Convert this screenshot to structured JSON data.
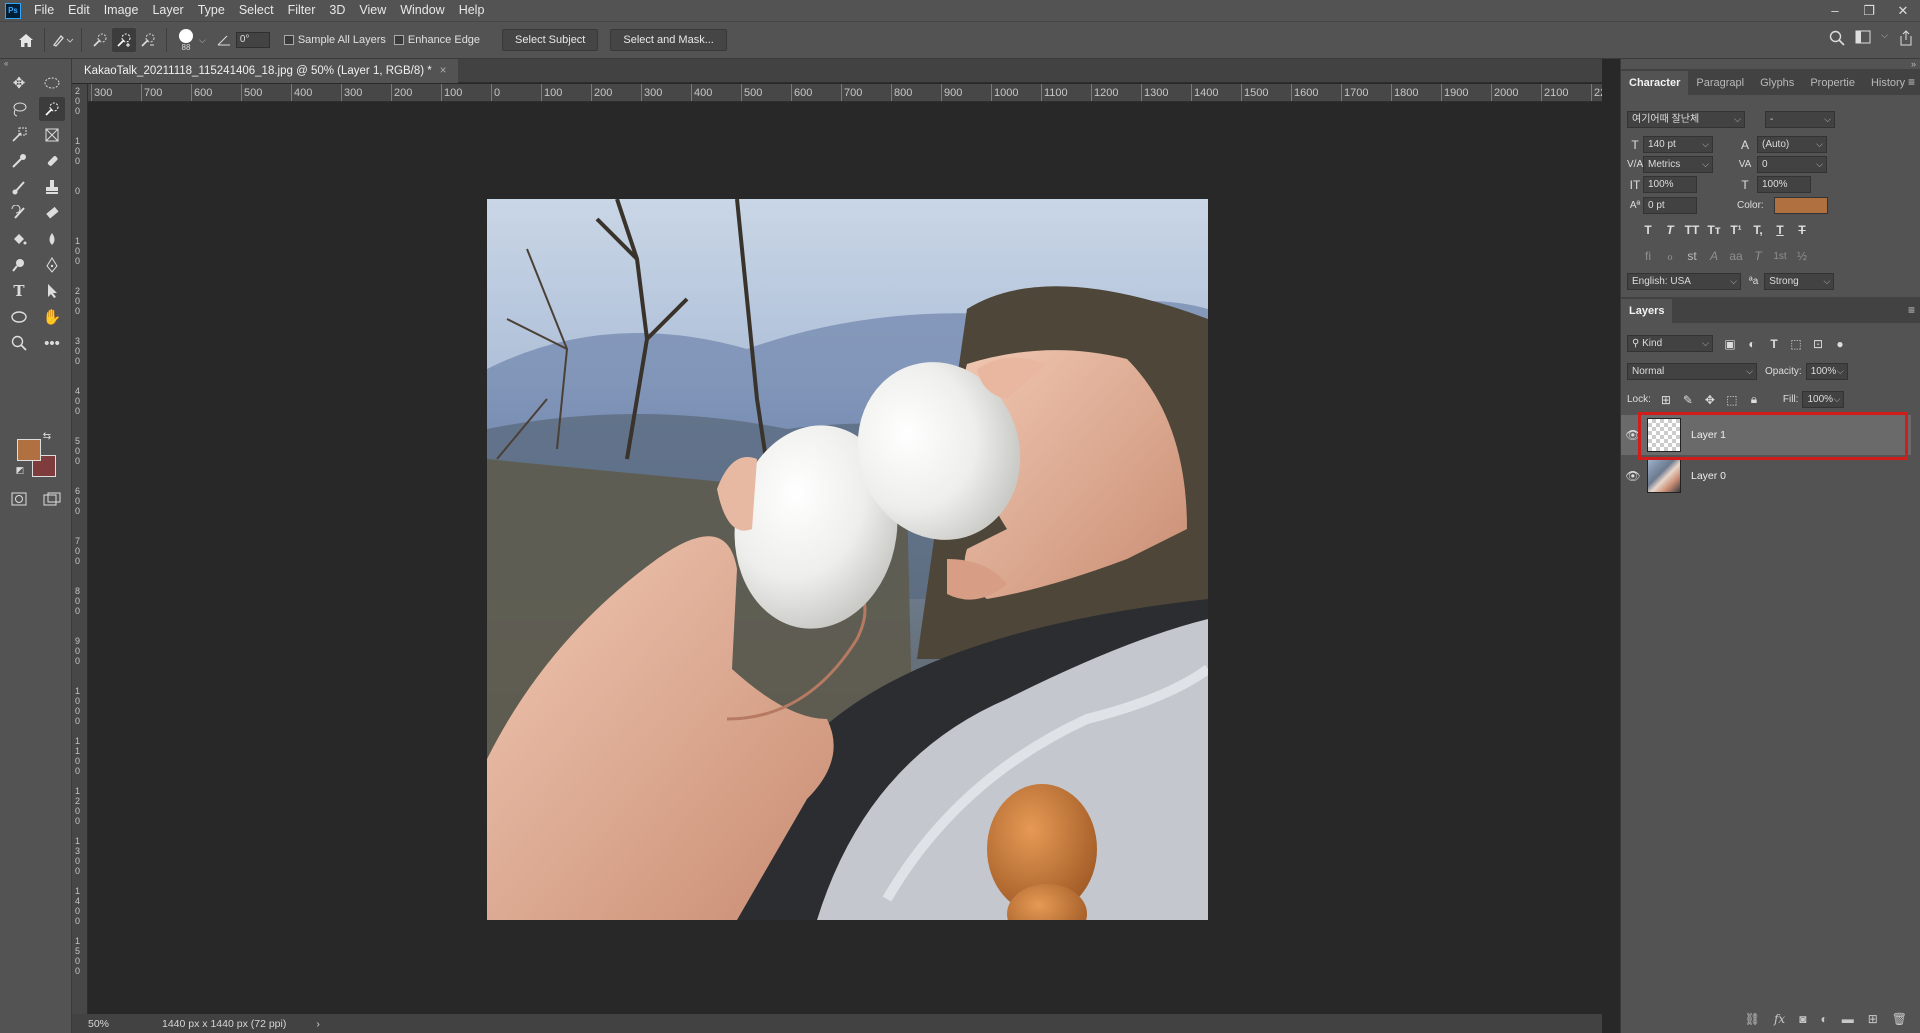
{
  "app": {
    "logo": "Ps"
  },
  "menu": [
    "File",
    "Edit",
    "Image",
    "Layer",
    "Type",
    "Select",
    "Filter",
    "3D",
    "View",
    "Window",
    "Help"
  ],
  "window_controls": {
    "minimize": "–",
    "restore": "❐",
    "close": "✕"
  },
  "options": {
    "brush_size": "88",
    "angle": "0°",
    "sample_all_layers": "Sample All Layers",
    "enhance_edge": "Enhance Edge",
    "select_subject": "Select Subject",
    "select_and_mask": "Select and Mask..."
  },
  "document": {
    "tab_title": "KakaoTalk_20211118_115241406_18.jpg @ 50% (Layer 1, RGB/8) *",
    "close": "×"
  },
  "ruler_h": [
    "300",
    "700",
    "600",
    "500",
    "400",
    "300",
    "200",
    "100",
    "0",
    "100",
    "200",
    "300",
    "400",
    "500",
    "600",
    "700",
    "800",
    "900",
    "1000",
    "1100",
    "1200",
    "1300",
    "1400",
    "1500",
    "1600",
    "1700",
    "1800",
    "1900",
    "2000",
    "2100",
    "22"
  ],
  "ruler_v": [
    "200",
    "100",
    "0",
    "100",
    "200",
    "300",
    "400",
    "500",
    "600",
    "700",
    "800",
    "900",
    "1000",
    "1100",
    "1200",
    "1300",
    "1400",
    "1500"
  ],
  "status": {
    "zoom": "50%",
    "doc_info": "1440 px x 1440 px (72 ppi)",
    "arrow": "›"
  },
  "colors": {
    "foreground": "#b0703f",
    "background": "#7e3c3c",
    "text_color": "#b0703f",
    "highlight": "#d21b1b"
  },
  "character_panel": {
    "tabs": [
      "Character",
      "Paragrapl",
      "Glyphs",
      "Propertie",
      "History"
    ],
    "font_family": "여기어때 잘난체",
    "font_style": "-",
    "font_size": "140 pt",
    "leading": "(Auto)",
    "kerning": "Metrics",
    "tracking": "0",
    "vertical_scale": "100%",
    "horizontal_scale": "100%",
    "baseline_shift": "0 pt",
    "color_label": "Color:",
    "type_buttons": [
      "T",
      "T",
      "TT",
      "Tт",
      "T¹",
      "T,",
      "T",
      "T"
    ],
    "opentype_buttons": [
      "fi",
      "ℴ",
      "st",
      "A",
      "aa",
      "T",
      "1st",
      "½"
    ],
    "language": "English: USA",
    "aa_label": "ªa",
    "antialias": "Strong"
  },
  "layers_panel": {
    "title": "Layers",
    "kind": "Kind",
    "blend_mode": "Normal",
    "opacity_label": "Opacity:",
    "opacity": "100%",
    "lock_label": "Lock:",
    "fill_label": "Fill:",
    "fill": "100%",
    "layers": [
      {
        "name": "Layer 1",
        "selected": true
      },
      {
        "name": "Layer 0",
        "selected": false
      }
    ],
    "footer_icons": [
      "link-icon",
      "fx-icon",
      "mask-icon",
      "adjustment-icon",
      "folder-icon",
      "new-layer-icon",
      "trash-icon"
    ]
  },
  "tools": [
    "move-tool",
    "marquee-tool",
    "lasso-tool",
    "quick-selection-tool",
    "object-selection-tool",
    "frame-tool",
    "eyedropper-tool",
    "healing-tool",
    "brush-tool",
    "stamp-tool",
    "history-brush-tool",
    "eraser-tool",
    "paint-bucket-tool",
    "blur-tool",
    "dodge-tool",
    "pen-tool",
    "type-tool",
    "path-selection-tool",
    "ellipse-tool",
    "hand-tool",
    "zoom-tool",
    "more-tools"
  ]
}
